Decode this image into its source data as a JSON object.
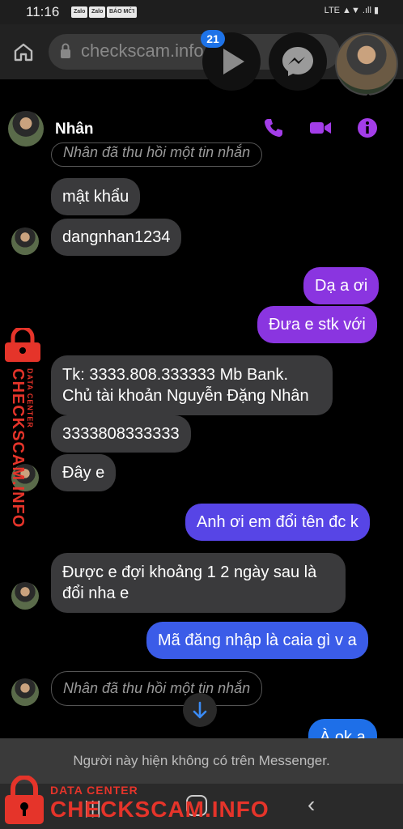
{
  "status_bar": {
    "time": "11:16",
    "app_icons": [
      "Zalo",
      "Zalo",
      "BÁO MỚI"
    ],
    "right": "LTE ▲▼ .ıll ▮"
  },
  "browser": {
    "url": "checkscam.info"
  },
  "chat_heads": {
    "badge_count": "21"
  },
  "chat": {
    "contact_name": "Nhân",
    "messages": [
      {
        "type": "recalled",
        "text": "Nhân đã thu hồi một tin nhắn"
      },
      {
        "type": "in",
        "text": "mật khẩu"
      },
      {
        "type": "in",
        "text": "dangnhan1234"
      },
      {
        "type": "out",
        "text": "Dạ a ơi"
      },
      {
        "type": "out",
        "text": "Đưa e stk với"
      },
      {
        "type": "in",
        "line1": "Tk: 3333.808.333333 Mb Bank.",
        "line2": "Chủ tài khoản Nguyễn Đặng Nhân"
      },
      {
        "type": "in",
        "text": "3333808333333"
      },
      {
        "type": "in",
        "text": "Đây e"
      },
      {
        "type": "out",
        "text": "Anh ơi em đổi tên đc k"
      },
      {
        "type": "in",
        "line1": "Được e đợi khoảng 1 2 ngày sau là",
        "line2": "đổi nha e"
      },
      {
        "type": "out",
        "text": "Mã đăng nhập là caia gì v a"
      },
      {
        "type": "recalled",
        "text": "Nhân đã thu hồi một tin nhắn"
      },
      {
        "type": "out",
        "text": "À ok a"
      }
    ]
  },
  "notice": "Người này hiện không có trên Messenger.",
  "watermark": {
    "small": "DATA CENTER",
    "big": "CHECKSCAM.INFO"
  },
  "colors": {
    "accent_purple": "#8a35e0",
    "accent_blue": "#3b5ce8",
    "watermark_red": "#e5342a"
  }
}
